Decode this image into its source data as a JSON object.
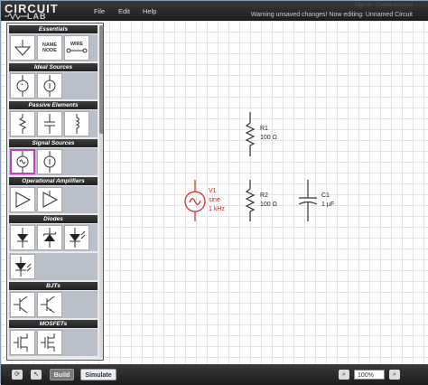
{
  "header": {
    "logo_top": "CIRCUIT",
    "logo_bottom": "LAB",
    "menus": [
      "File",
      "Edit",
      "Help"
    ],
    "status": "Warning unsaved changes! Now editing: Unnamed Circuit",
    "sublink": "Sign in · Create account"
  },
  "palette": {
    "categories": [
      "Essentials",
      "Ideal Sources",
      "Passive Elements",
      "Signal Sources",
      "Operational Amplifiers",
      "Diodes",
      "BJTs",
      "MOSFETs"
    ],
    "essentials": {
      "name_node_line1": "NAME",
      "name_node_line2": "NODE",
      "wire": "WIRE"
    }
  },
  "components": {
    "r1": {
      "name": "R1",
      "value": "100 Ω"
    },
    "r2": {
      "name": "R2",
      "value": "100 Ω"
    },
    "c1": {
      "name": "C1",
      "value": "1 µF"
    },
    "v1": {
      "name": "V1",
      "type": "sine",
      "freq": "1 kHz"
    }
  },
  "footer": {
    "build": "Build",
    "simulate": "Simulate",
    "zoom": "100%"
  },
  "colors": {
    "selected": "#e0201c",
    "wire": "#333333",
    "accent": "#c040c0"
  }
}
